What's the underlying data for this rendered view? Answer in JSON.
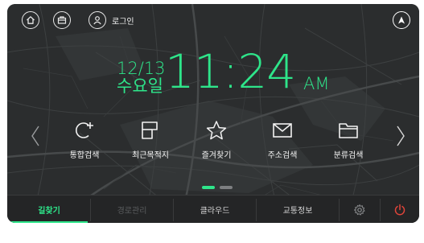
{
  "header": {
    "login_label": "로그인",
    "icons": [
      "home-icon",
      "briefcase-icon",
      "user-icon",
      "navigation-arrow-icon"
    ]
  },
  "clock": {
    "date": "12/13",
    "weekday": "수요일",
    "time": "11:24",
    "ampm": "AM"
  },
  "quick_menu": {
    "items": [
      {
        "label": "통합검색",
        "icon": "search-plus-icon"
      },
      {
        "label": "최근목적지",
        "icon": "recent-destination-icon"
      },
      {
        "label": "즐겨찾기",
        "icon": "star-icon"
      },
      {
        "label": "주소검색",
        "icon": "envelope-icon"
      },
      {
        "label": "분류검색",
        "icon": "folder-icon"
      }
    ],
    "page": 1,
    "page_count": 2
  },
  "tabbar": {
    "tabs": [
      {
        "label": "길찾기",
        "state": "active"
      },
      {
        "label": "경로관리",
        "state": "disabled"
      },
      {
        "label": "클라우드",
        "state": "normal"
      },
      {
        "label": "교통정보",
        "state": "normal"
      }
    ],
    "icons": [
      "settings-icon",
      "power-icon"
    ]
  },
  "colors": {
    "accent": "#2ee58a",
    "power": "#e0453a",
    "background": "#2b2d2e"
  }
}
